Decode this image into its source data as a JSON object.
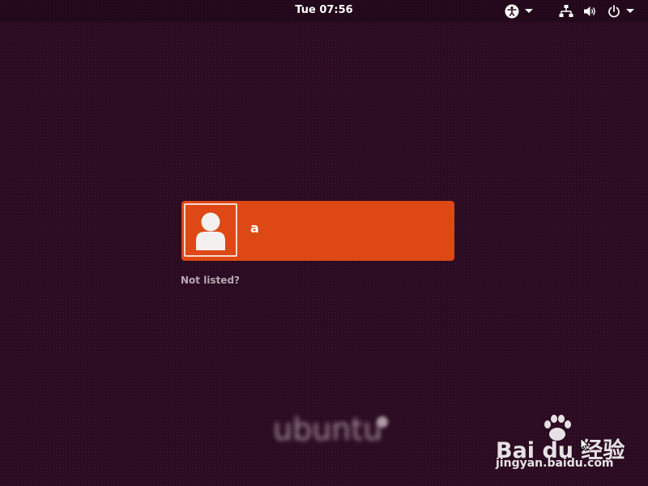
{
  "top_bar": {
    "clock": "Tue 07:56",
    "icons": [
      "accessibility-icon",
      "chevron-down-icon",
      "network-icon",
      "volume-icon",
      "power-icon",
      "chevron-down-icon"
    ]
  },
  "login": {
    "users": [
      {
        "name": "a",
        "avatar": "user-avatar-icon"
      }
    ],
    "not_listed_label": "Not listed?"
  },
  "branding": {
    "logo_text": "ubuntu"
  },
  "watermark": {
    "brand": "Bai du 经验",
    "url": "jingyan.baidu.com"
  },
  "colors": {
    "background": "#2c0b22",
    "accent": "#dd4814"
  }
}
